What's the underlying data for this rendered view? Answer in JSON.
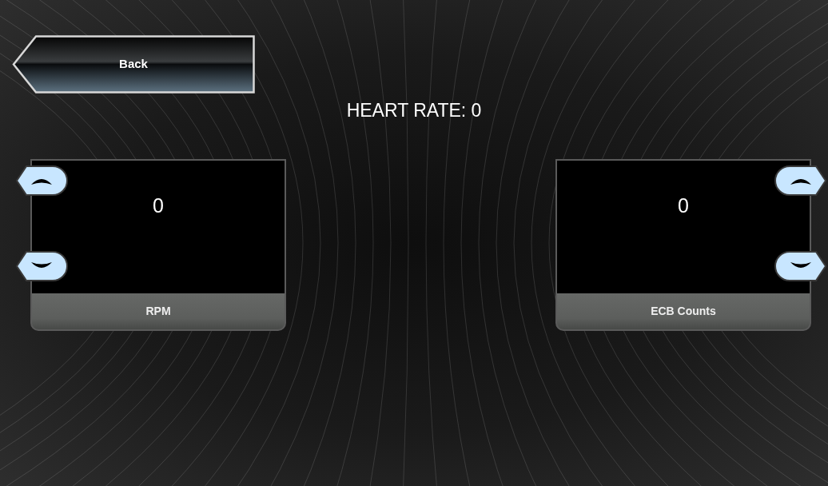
{
  "back_button": {
    "label": "Back"
  },
  "heading": "HEART RATE: 0",
  "panels": [
    {
      "kind": "left",
      "value": "0",
      "label": "RPM"
    },
    {
      "kind": "right",
      "value": "0",
      "label": "ECB Counts"
    }
  ]
}
